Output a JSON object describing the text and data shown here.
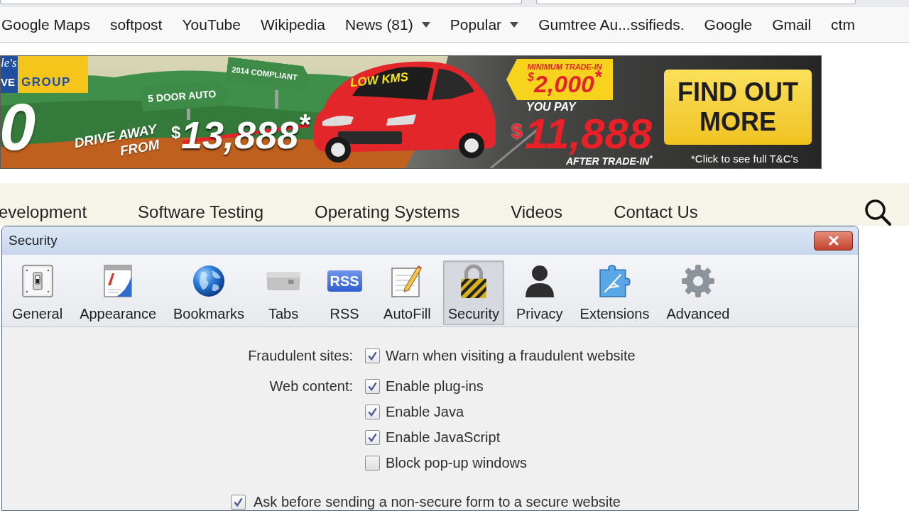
{
  "bookmarks_bar": [
    {
      "label": "Google Maps",
      "dropdown": false
    },
    {
      "label": "softpost",
      "dropdown": false
    },
    {
      "label": "YouTube",
      "dropdown": false
    },
    {
      "label": "Wikipedia",
      "dropdown": false
    },
    {
      "label": "News (81)",
      "dropdown": true
    },
    {
      "label": "Popular",
      "dropdown": true
    },
    {
      "label": "Gumtree Au...ssifieds.",
      "dropdown": false
    },
    {
      "label": "Google",
      "dropdown": false
    },
    {
      "label": "Gmail",
      "dropdown": false
    },
    {
      "label": "ctm",
      "dropdown": false
    }
  ],
  "ad_banner": {
    "logo": [
      "le's",
      "VE",
      "GROUP"
    ],
    "big_digit": "0",
    "signs": [
      "5 DOOR AUTO",
      "2014 COMPLIANT"
    ],
    "drive_away": [
      "DRIVE AWAY",
      "FROM"
    ],
    "old_price": {
      "currency": "$",
      "amount": "13,888$^{*}$"
    },
    "windshield": "LOW KMS",
    "trade_in": {
      "label": "MINIMUM TRADE-IN",
      "currency": "$",
      "amount": "2,000$^{*}$"
    },
    "you_pay": {
      "label": "YOU PAY",
      "currency": "$",
      "amount": "11,888",
      "note": "AFTER TRADE-IN$^{*}$"
    },
    "cta": "FIND OUT MORE",
    "terms": "*Click to see full T&C's"
  },
  "site_nav": {
    "links": [
      "evelopment",
      "Software Testing",
      "Operating Systems",
      "Videos",
      "Contact Us"
    ]
  },
  "dialog": {
    "title": "Security",
    "tabs": [
      {
        "label": "General",
        "selected": false
      },
      {
        "label": "Appearance",
        "selected": false
      },
      {
        "label": "Bookmarks",
        "selected": false
      },
      {
        "label": "Tabs",
        "selected": false
      },
      {
        "label": "RSS",
        "icon_text": "RSS",
        "selected": false
      },
      {
        "label": "AutoFill",
        "selected": false
      },
      {
        "label": "Security",
        "selected": true
      },
      {
        "label": "Privacy",
        "selected": false
      },
      {
        "label": "Extensions",
        "selected": false
      },
      {
        "label": "Advanced",
        "selected": false
      }
    ],
    "settings": [
      {
        "label": "Fraudulent sites:",
        "options": [
          {
            "text": "Warn when visiting a fraudulent website",
            "checked": true
          }
        ]
      },
      {
        "label": "Web content:",
        "options": [
          {
            "text": "Enable plug-ins",
            "checked": true
          },
          {
            "text": "Enable Java",
            "checked": true
          },
          {
            "text": "Enable JavaScript",
            "checked": true
          },
          {
            "text": "Block pop-up windows",
            "checked": false
          }
        ]
      }
    ],
    "form_warning": {
      "text": "Ask before sending a non-secure form to a secure website",
      "checked": true
    }
  }
}
